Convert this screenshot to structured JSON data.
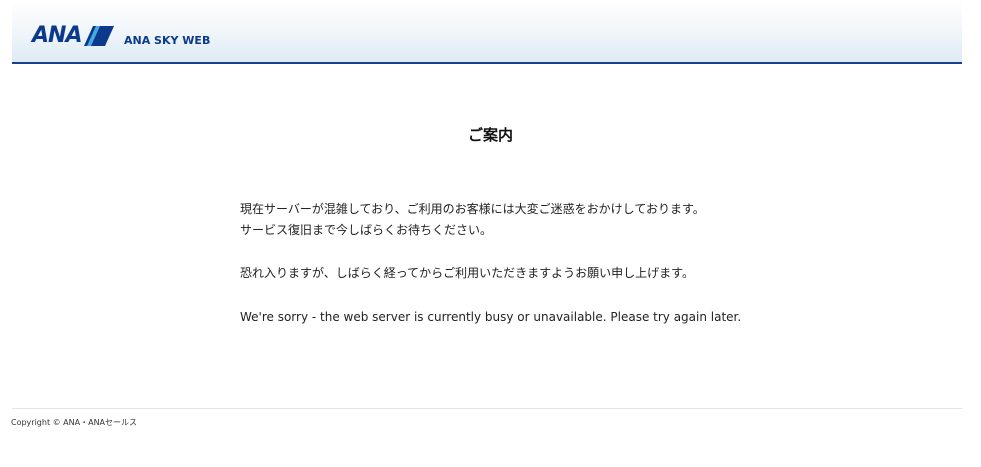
{
  "header": {
    "logo_text": "ANA",
    "site_name": "ANA SKY WEB",
    "brand_color": "#0b3a8c",
    "accent_color": "#1a3f8f",
    "logo_icon": "ana-wing-stripes-icon"
  },
  "main": {
    "title": "ご案内",
    "paragraphs": [
      "現在サーバーが混雑しており、ご利用のお客様には大変ご迷惑をおかけしております。",
      "サービス復旧まで今しばらくお待ちください。",
      "恐れ入りますが、しばらく経ってからご利用いただきますようお願い申し上げます。",
      "We're sorry - the web server is currently busy or unavailable. Please try again later."
    ]
  },
  "footer": {
    "copyright": "Copyright © ANA・ANAセールス"
  }
}
